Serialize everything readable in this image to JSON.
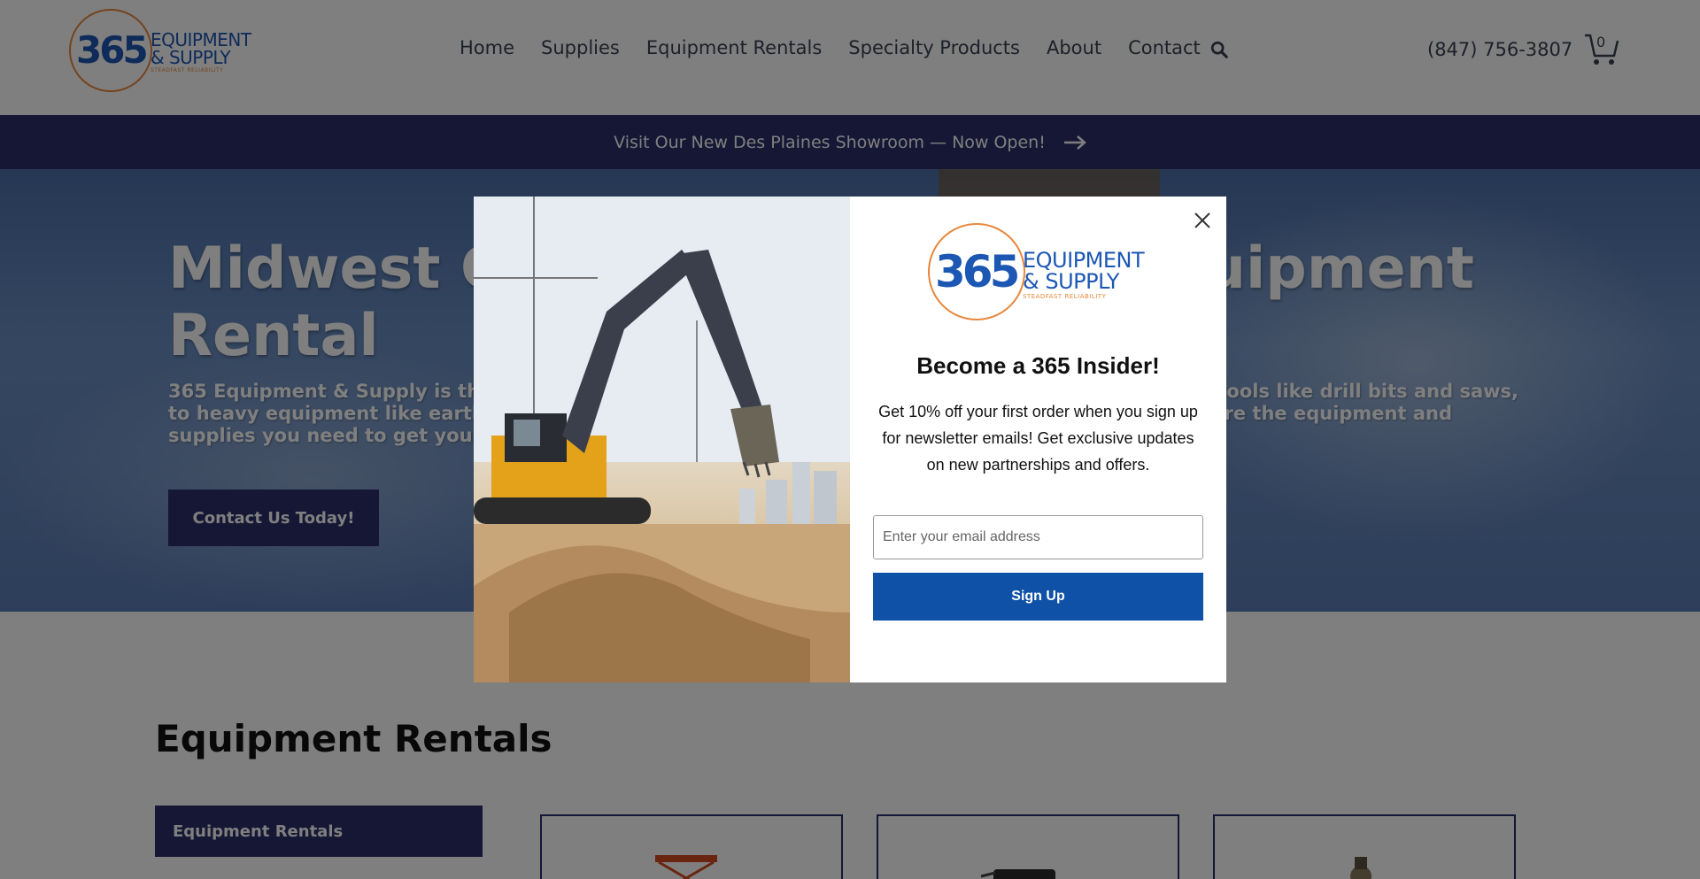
{
  "header": {
    "logo": {
      "number": "365",
      "line1": "EQUIPMENT",
      "line2": "& SUPPLY",
      "tagline": "STEADFAST RELIABILITY"
    },
    "nav": [
      "Home",
      "Supplies",
      "Equipment Rentals",
      "Specialty Products",
      "About",
      "Contact"
    ],
    "search_icon": "search-icon",
    "phone": "(847) 756-3807",
    "cart_count": "0"
  },
  "banner": {
    "text": "Visit Our New Des Plaines Showroom — Now Open!",
    "arrow_icon": "arrow-right-icon"
  },
  "hero": {
    "title_line1_left": "Midwest C",
    "title_line1_right": "uipment",
    "title_line2": "Rental",
    "desc_line1_left": "365 Equipment & Supply is the l",
    "desc_line1_right": "all tools like drill bits and saws,",
    "desc_line2_left": "to heavy equipment like earthm",
    "desc_line2_right": "ure the equipment and",
    "desc_line3_left": "supplies you need to get your jo",
    "button": "Contact Us Today!"
  },
  "section": {
    "title": "Equipment Rentals",
    "side_tab": "Equipment Rentals"
  },
  "modal": {
    "logo": {
      "number": "365",
      "line1": "EQUIPMENT",
      "line2": "& SUPPLY",
      "tagline": "STEADFAST RELIABILITY"
    },
    "title": "Become a 365 Insider!",
    "description": "Get 10% off your first order when you sign up for newsletter emails! Get exclusive updates on new partnerships and offers.",
    "email_placeholder": "Enter your email address",
    "signup_button": "Sign Up",
    "close_icon": "close-icon"
  },
  "colors": {
    "brand_navy": "#2a2f6b",
    "brand_blue": "#1c57b3",
    "brand_orange": "#e8863a",
    "signup_blue": "#0e51a7"
  }
}
